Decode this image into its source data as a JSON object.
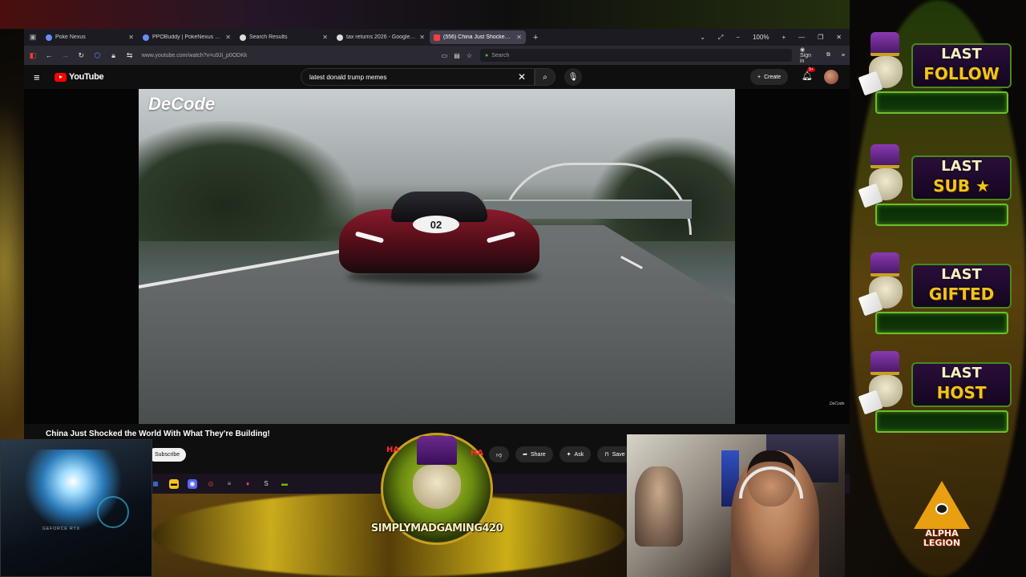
{
  "browser": {
    "tabs": [
      {
        "label": "Poke Nexus",
        "active": false
      },
      {
        "label": "PPOBuddy | PokeNexus Databa",
        "active": false
      },
      {
        "label": "Search Results",
        "active": false
      },
      {
        "label": "tax returns 2026 - Google Searc",
        "active": false
      },
      {
        "label": "(556) China Just Shocked th",
        "active": true
      }
    ],
    "zoom": "100%",
    "url": "www.youtube.com/watch?v=u9Ji_p0ODKk",
    "search_placeholder": "Search",
    "sign_in": "Sign in"
  },
  "youtube": {
    "logo": "YouTube",
    "search_query": "latest donald trump memes",
    "create_label": "Create",
    "notifications_badge": "9+",
    "video": {
      "watermark": "DeCode",
      "watermark_small": "DeCode",
      "car_number": "02",
      "title": "China Just Shocked the World With What They're Building!"
    },
    "subscribe_label": "Subscribe",
    "actions": {
      "share": "Share",
      "ask": "Ask",
      "save": "Save"
    }
  },
  "overlays": {
    "pc_cam_label": "GEFORCE RTX",
    "channel_badge": "SIMPLYMADGAMING420",
    "ha_left": "HA",
    "ha_right": "HA",
    "legion_line1": "ALPHA",
    "legion_line2": "LEGION"
  },
  "alerts": [
    {
      "line1": "LAST",
      "line2": "FOLLOW",
      "icon": "cursor-icon"
    },
    {
      "line1": "LAST",
      "line2": "SUB",
      "icon": "star-icon"
    },
    {
      "line1": "LAST",
      "line2": "GIFTED",
      "icon": "gift-icon"
    },
    {
      "line1": "LAST",
      "line2": "HOST",
      "icon": "host-icon"
    }
  ],
  "colors": {
    "yt_red": "#ff0000",
    "alert_gold": "#f2c41a",
    "alert_green": "#6ac02a"
  }
}
